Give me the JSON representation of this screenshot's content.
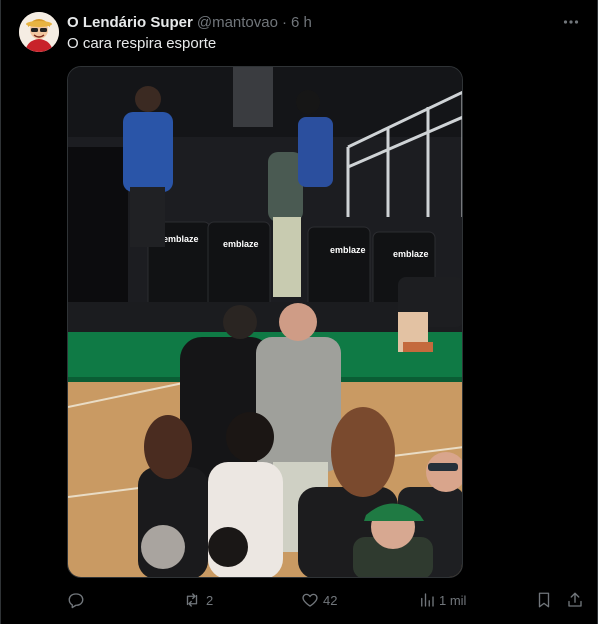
{
  "tweet": {
    "author": {
      "display_name": "O Lendário Super",
      "handle": "@mantovao",
      "separator": "·",
      "time": "6 h"
    },
    "text": "O cara respira esporte",
    "media": {
      "court_logo_text": "emblaze"
    },
    "actions": {
      "reply": {
        "icon": "reply-icon"
      },
      "retweet": {
        "icon": "retweet-icon",
        "count": "2"
      },
      "like": {
        "icon": "heart-icon",
        "count": "42"
      },
      "views": {
        "icon": "views-icon",
        "count": "1 mil"
      },
      "bookmark": {
        "icon": "bookmark-icon"
      },
      "share": {
        "icon": "share-icon"
      }
    }
  },
  "colors": {
    "background": "#000000",
    "text_primary": "#e7e9ea",
    "text_secondary": "#71767b",
    "court_green": "#0f7a45",
    "court_wood": "#c99a63"
  }
}
